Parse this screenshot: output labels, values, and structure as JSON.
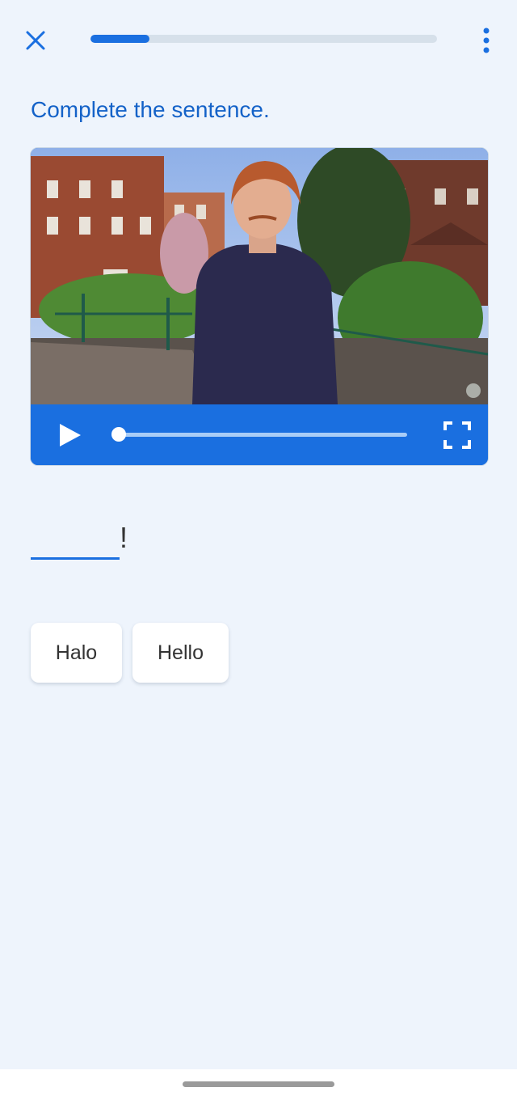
{
  "header": {
    "close_icon": "close-icon",
    "menu_icon": "more-vert-icon",
    "progress": 0.17
  },
  "prompt": "Complete the sentence.",
  "video": {
    "play_icon": "play-icon",
    "fullscreen_icon": "fullscreen-icon",
    "position": 0.0
  },
  "sentence": {
    "punctuation": "!"
  },
  "options": [
    {
      "label": "Halo"
    },
    {
      "label": "Hello"
    }
  ],
  "colors": {
    "accent": "#1a6fe0",
    "prompt": "#1462c8",
    "background": "#eef4fc"
  }
}
